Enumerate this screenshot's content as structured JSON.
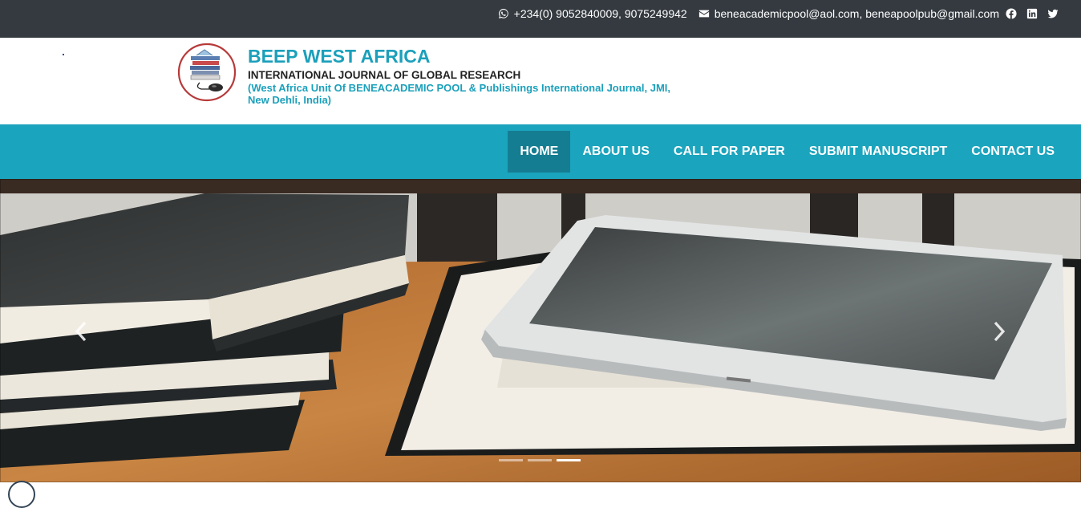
{
  "topbar": {
    "phone": "+234(0) 9052840009, 9075249942",
    "email": "beneacademicpool@aol.com, beneapoolpub@gmail.com",
    "icons": [
      "whatsapp-icon",
      "envelope-icon",
      "facebook-icon",
      "linkedin-icon",
      "twitter-icon"
    ]
  },
  "brand": {
    "title": "BEEP WEST AFRICA",
    "subtitle": "INTERNATIONAL JOURNAL OF GLOBAL RESEARCH",
    "tagline": "(West Africa Unit Of BENEACADEMIC POOL & Publishings International Journal, JMI, New Dehli, India)"
  },
  "nav": {
    "items": [
      {
        "label": "HOME",
        "active": true
      },
      {
        "label": "ABOUT US",
        "active": false
      },
      {
        "label": "CALL FOR PAPER",
        "active": false
      },
      {
        "label": "SUBMIT MANUSCRIPT",
        "active": false
      },
      {
        "label": "CONTACT US",
        "active": false
      }
    ]
  },
  "carousel": {
    "slide_count": 3,
    "active_index": 2,
    "controls": [
      "chevron-left-icon",
      "chevron-right-icon"
    ]
  },
  "colors": {
    "topbar": "#343a40",
    "accent": "#1ba4bd",
    "nav_active": "#157d92"
  }
}
